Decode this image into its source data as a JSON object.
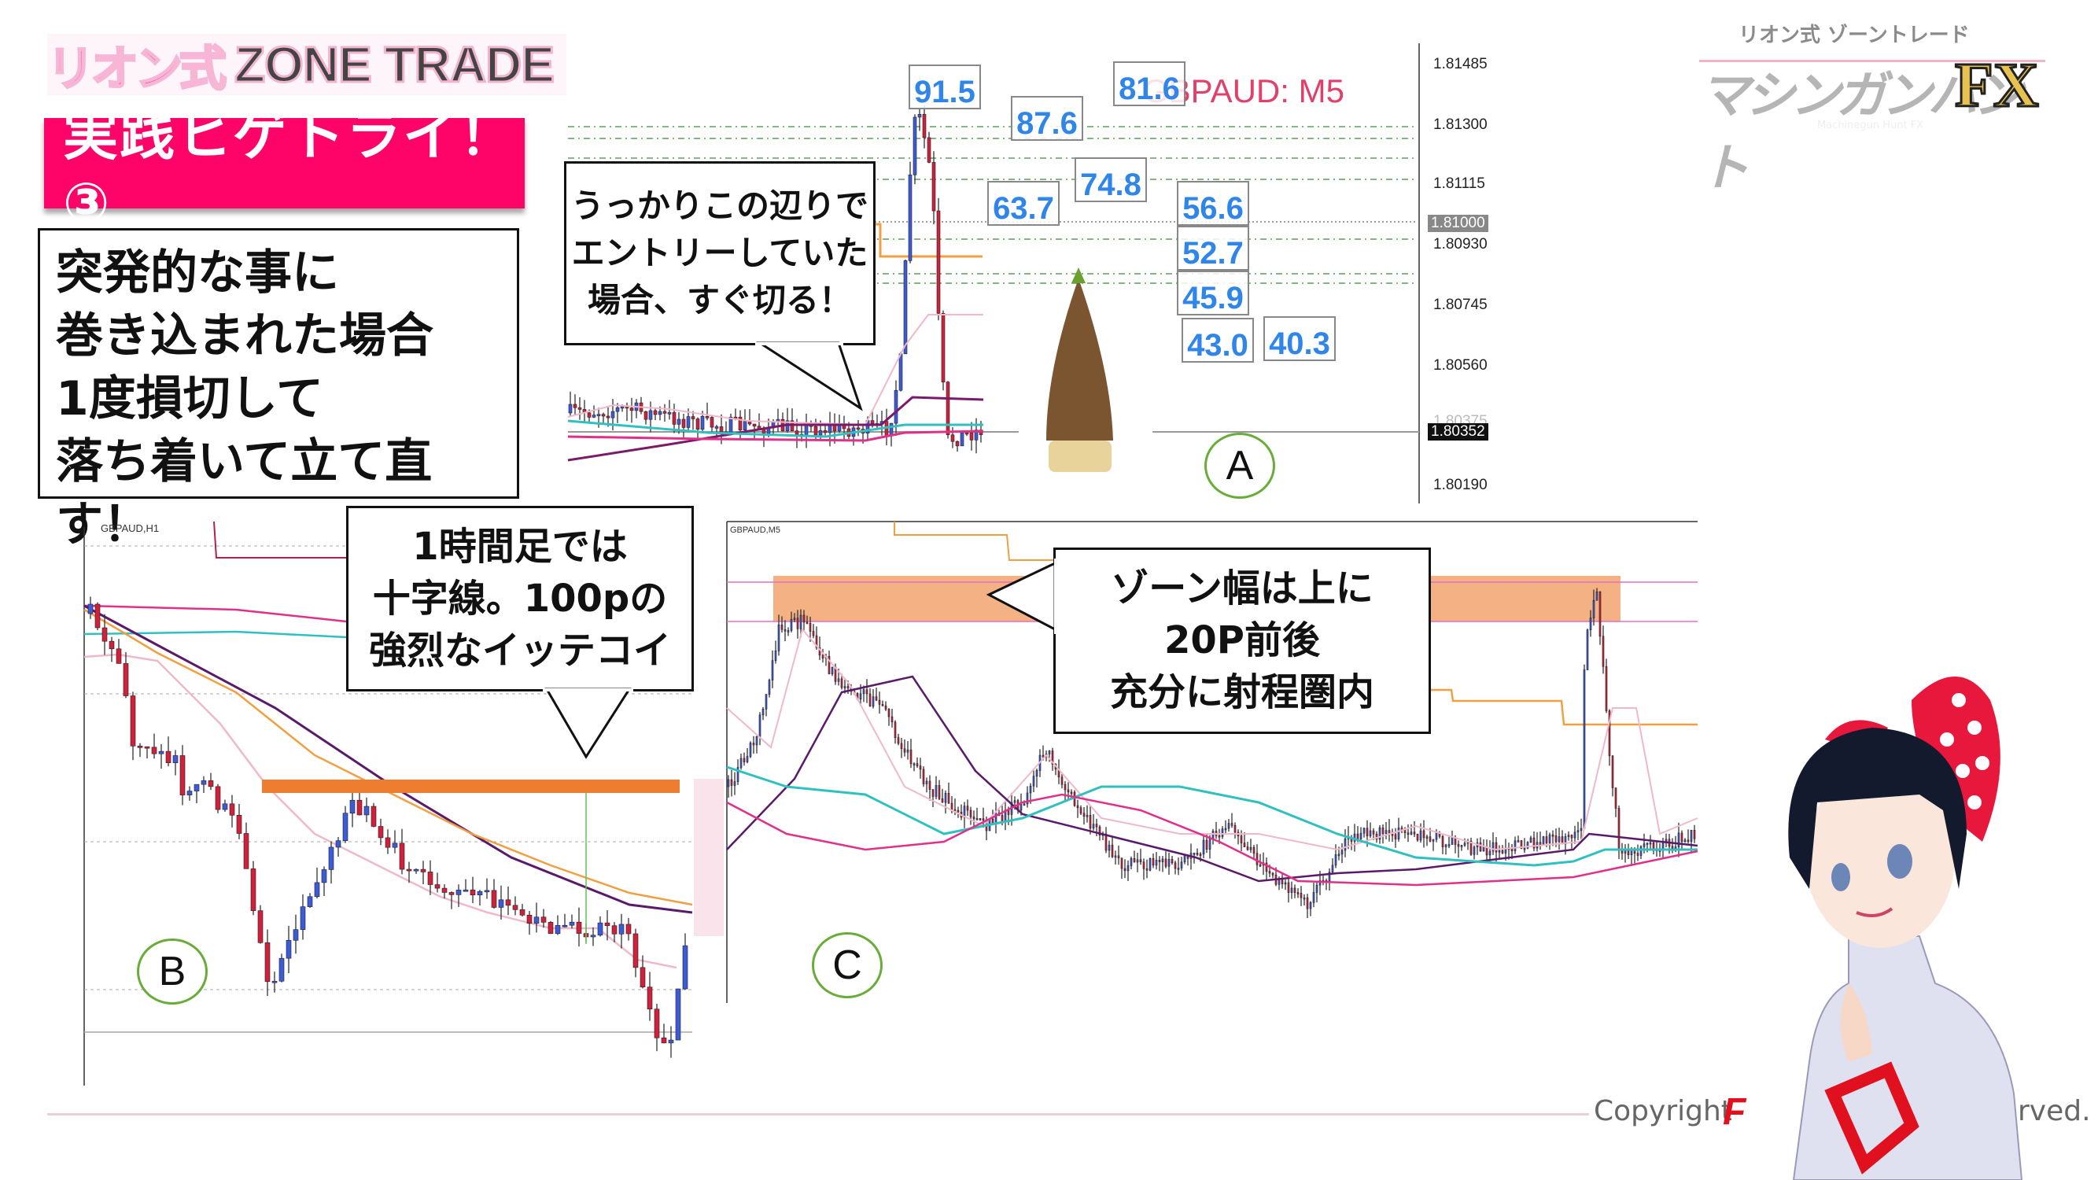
{
  "logo_left": {
    "jp": "リオン式",
    "en": "ZONE TRADE"
  },
  "title": "実践ヒゲトライ！③",
  "main_text": [
    "突発的な事に",
    "巻き込まれた場合",
    "1度損切して",
    "落ち着いて立て直す！"
  ],
  "logo_right": {
    "top": "リオン式 ゾーントレード",
    "main": "マシンガンハント",
    "fx": "FX",
    "sub": "Machinegun Hunt FX"
  },
  "chart_a": {
    "symbol_label": "GBPAUD: M5",
    "price_labels": [
      "1.81485",
      "1.81300",
      "1.81115",
      "1.81000",
      "1.80930",
      "1.80745",
      "1.80560",
      "1.80375",
      "1.80352",
      "1.80190"
    ],
    "value_boxes": [
      "91.5",
      "87.6",
      "81.6",
      "63.7",
      "74.8",
      "56.6",
      "52.7",
      "45.9",
      "43.0",
      "40.3"
    ],
    "callout": [
      "うっかりこの辺りで",
      "エントリーしていた",
      "場合、すぐ切る！"
    ],
    "marker": "A"
  },
  "chart_b": {
    "symbol": "GBPAUD,H1",
    "callout": [
      "1時間足では",
      "十字線。100pの",
      "強烈なイッテコイ"
    ],
    "marker": "B"
  },
  "chart_c": {
    "symbol": "GBPAUD,M5",
    "callout": [
      "ゾーン幅は上に",
      "20P前後",
      "充分に射程圏内"
    ],
    "marker": "C"
  },
  "footer": {
    "copyright_start": "Copyright",
    "copyright_end": "rved."
  },
  "colors": {
    "accent": "#ff0468",
    "zone": "#f2a36f",
    "zone_bar": "#ef7d2f",
    "value_text": "#2f86e8",
    "bull": "#3d5bd6",
    "bear": "#d0203c",
    "marker_ring": "#6aac3c"
  }
}
